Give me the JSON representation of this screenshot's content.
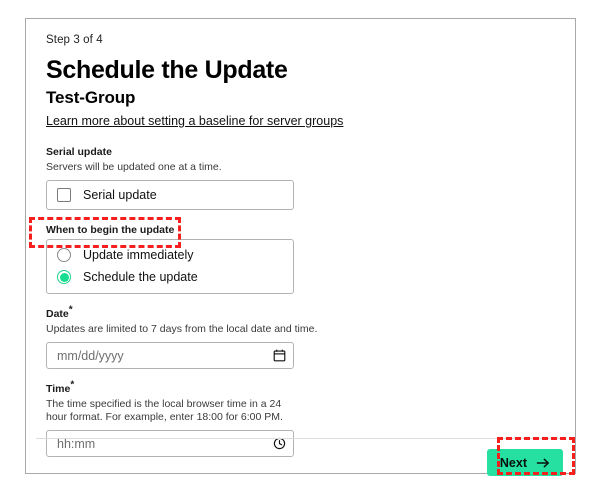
{
  "wizard": {
    "step_label": "Step 3 of 4",
    "title": "Schedule the Update",
    "subtitle": "Test-Group",
    "learn_more_link": "Learn more about setting a baseline for server groups"
  },
  "serial_update": {
    "label": "Serial update",
    "help": "Servers will be updated one at a time.",
    "checkbox_label": "Serial update",
    "checked": false
  },
  "when_to_begin": {
    "label": "When to begin the update",
    "options": [
      {
        "label": "Update immediately",
        "selected": false
      },
      {
        "label": "Schedule the update",
        "selected": true
      }
    ]
  },
  "date_field": {
    "label": "Date",
    "required_marker": "*",
    "help": "Updates are limited to 7 days from the local date and time.",
    "placeholder": "mm/dd/yyyy",
    "value": "",
    "icon": "calendar-icon"
  },
  "time_field": {
    "label": "Time",
    "required_marker": "*",
    "help": "The time specified is the local browser time in a 24 hour format. For example, enter 18:00 for 6:00 PM.",
    "placeholder": "hh:mm",
    "value": "",
    "icon": "clock-icon"
  },
  "footer": {
    "next_label": "Next",
    "next_icon": "arrow-right-icon"
  },
  "colors": {
    "accent_green": "#25e0a0",
    "radio_green": "#16dd90",
    "highlight_red": "#f51f1f",
    "border_gray": "#b3b3b3",
    "card_border": "#a9a9a9",
    "text_primary": "#111111"
  }
}
